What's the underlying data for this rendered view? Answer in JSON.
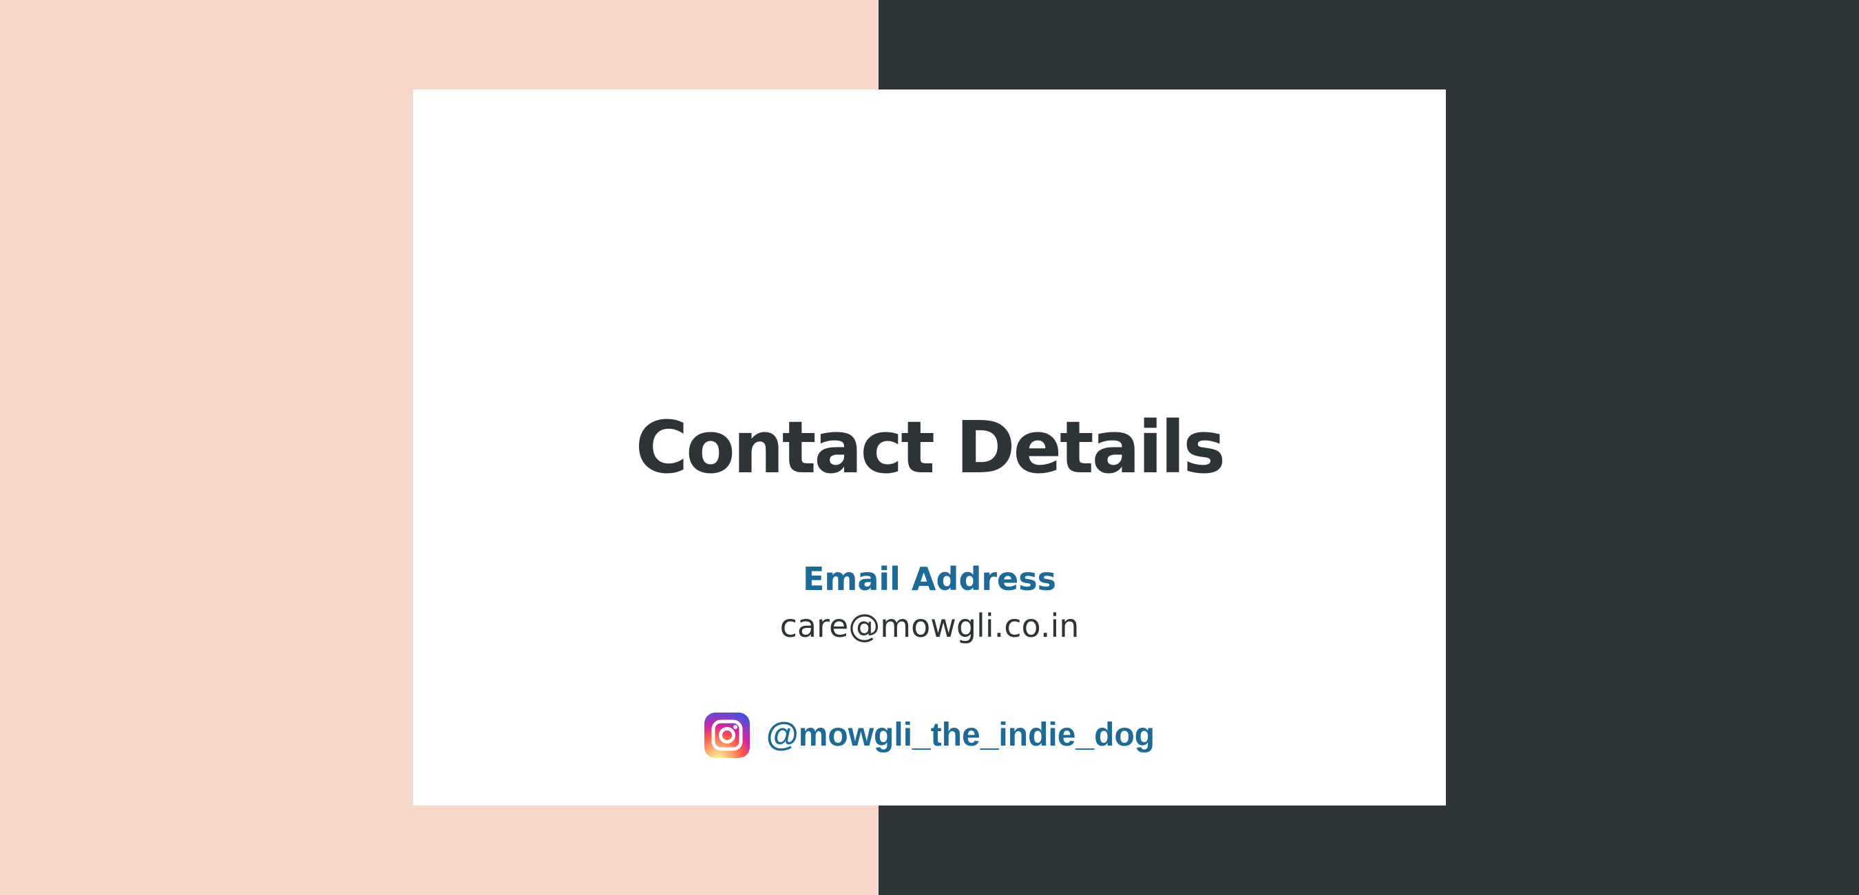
{
  "slide": {
    "title": "Contact Details",
    "email_label": "Email Address",
    "email_value": "care@mowgli.co.in",
    "instagram_handle": "@mowgli_the_indie_dog",
    "icons": {
      "social": "instagram-icon"
    },
    "colors": {
      "left_panel": "#f7d7ca",
      "right_panel": "#2d3438",
      "card": "#ffffff",
      "title": "#2d3438",
      "accent": "#1e6a96"
    }
  }
}
